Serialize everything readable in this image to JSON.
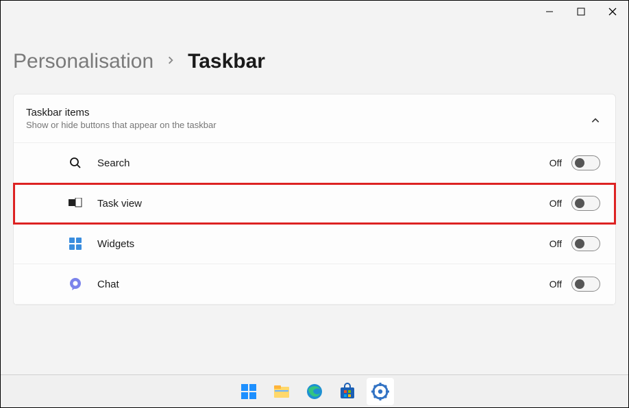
{
  "breadcrumb": {
    "parent": "Personalisation",
    "current": "Taskbar"
  },
  "section": {
    "title": "Taskbar items",
    "subtitle": "Show or hide buttons that appear on the taskbar"
  },
  "items": [
    {
      "label": "Search",
      "state": "Off",
      "icon": "search-icon",
      "highlight": false
    },
    {
      "label": "Task view",
      "state": "Off",
      "icon": "taskview-icon",
      "highlight": true
    },
    {
      "label": "Widgets",
      "state": "Off",
      "icon": "widgets-icon",
      "highlight": false
    },
    {
      "label": "Chat",
      "state": "Off",
      "icon": "chat-icon",
      "highlight": false
    }
  ],
  "taskbar_apps": [
    {
      "name": "start",
      "active": false
    },
    {
      "name": "file-explorer",
      "active": false
    },
    {
      "name": "edge",
      "active": false
    },
    {
      "name": "store",
      "active": false
    },
    {
      "name": "settings",
      "active": true
    }
  ]
}
